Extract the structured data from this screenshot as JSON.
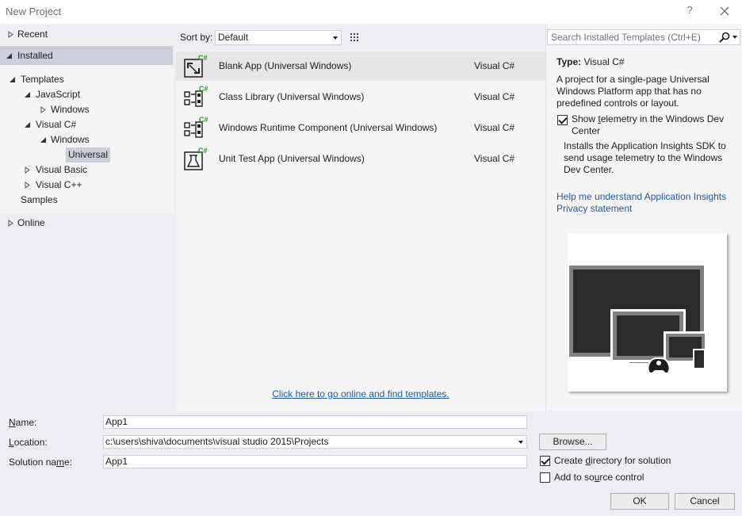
{
  "window": {
    "title": "New Project",
    "help": "?"
  },
  "tree": {
    "recent": "Recent",
    "installed": "Installed",
    "templates": "Templates",
    "javascript": "JavaScript",
    "js_windows": "Windows",
    "visual_csharp": "Visual C#",
    "cs_windows": "Windows",
    "universal": "Universal",
    "visual_basic": "Visual Basic",
    "visual_cpp": "Visual C++",
    "samples": "Samples",
    "online": "Online"
  },
  "sort": {
    "label": "Sort by:",
    "value": "Default"
  },
  "templates": [
    {
      "name": "Blank App (Universal Windows)",
      "lang": "Visual C#",
      "selected": true
    },
    {
      "name": "Class Library (Universal Windows)",
      "lang": "Visual C#"
    },
    {
      "name": "Windows Runtime Component (Universal Windows)",
      "lang": "Visual C#"
    },
    {
      "name": "Unit Test App (Universal Windows)",
      "lang": "Visual C#"
    }
  ],
  "online_link": "Click here to go online and find templates.",
  "search": {
    "placeholder": "Search Installed Templates (Ctrl+E)"
  },
  "details": {
    "type_label": "Type:",
    "type_value": "Visual C#",
    "description": "A project for a single-page Universal Windows Platform app that has no predefined controls or layout.",
    "telemetry_label": "Show telemetry in the Windows Dev Center",
    "telemetry_checked": true,
    "telemetry_desc": "Installs the Application Insights SDK to send usage telemetry to the Windows Dev Center.",
    "help_link": "Help me understand Application Insights",
    "privacy_link": "Privacy statement"
  },
  "form": {
    "name_label": "Name:",
    "name_value": "App1",
    "location_label": "Location:",
    "location_value": "c:\\users\\shiva\\documents\\visual studio 2015\\Projects",
    "solution_label": "Solution name:",
    "solution_value": "App1",
    "browse": "Browse...",
    "create_dir": "Create directory for solution",
    "create_dir_checked": true,
    "source_control": "Add to source control",
    "source_control_checked": false,
    "ok": "OK",
    "cancel": "Cancel"
  },
  "colors": {
    "link": "#1e5aa8",
    "panel": "#eeeef2",
    "selected": "#cccedb",
    "csharp_badge": "#388a34"
  }
}
